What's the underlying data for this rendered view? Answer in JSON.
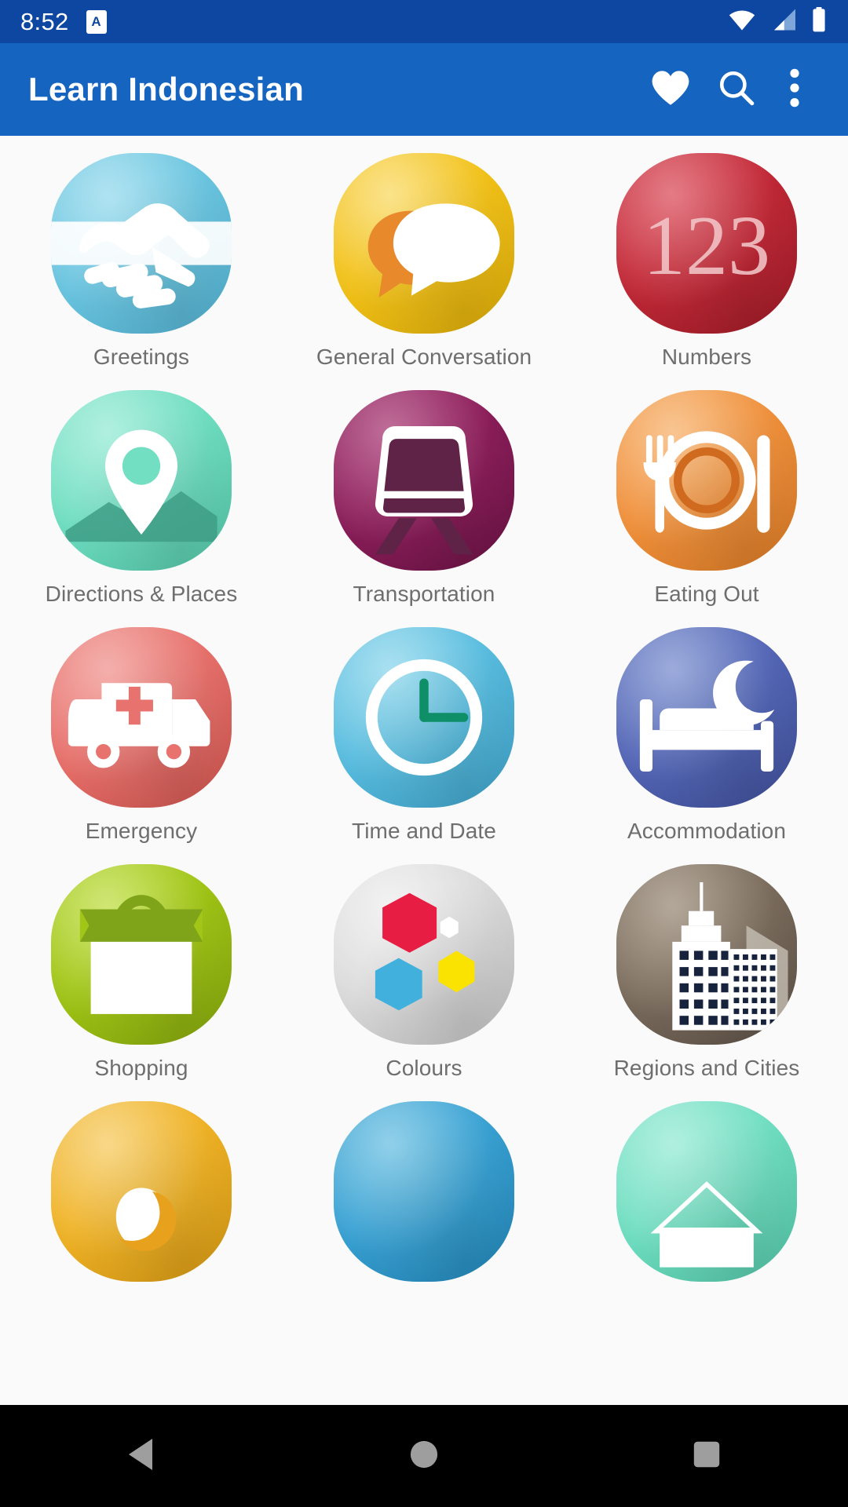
{
  "status_bar": {
    "time": "8:52",
    "app_badge_letter": "A",
    "icons": [
      "wifi-icon",
      "cell-signal-icon",
      "battery-icon"
    ],
    "background": "#0D47A1"
  },
  "app_bar": {
    "title": "Learn Indonesian",
    "background": "#1565C0",
    "actions": [
      {
        "name": "favorites-button",
        "icon": "heart-icon"
      },
      {
        "name": "search-button",
        "icon": "search-icon"
      },
      {
        "name": "overflow-menu-button",
        "icon": "more-vertical-icon"
      }
    ]
  },
  "grid": {
    "columns": 3,
    "background": "#FAFAFA",
    "label_color": "#6E6E6E",
    "categories": [
      {
        "label": "Greetings",
        "icon": "handshake-icon",
        "color": "#6FC7E1",
        "color_dark": "#4FB3D4"
      },
      {
        "label": "General Conversation",
        "icon": "speech-bubbles-icon",
        "color": "#F2C21A",
        "color_dark": "#E8B400"
      },
      {
        "label": "Numbers",
        "icon": "numbers-123-icon",
        "color": "#C42A38",
        "color_dark": "#A81F2C"
      },
      {
        "label": "Directions & Places",
        "icon": "map-pin-icon",
        "color": "#72DFC2",
        "color_dark": "#56CCAC"
      },
      {
        "label": "Transportation",
        "icon": "train-icon",
        "color": "#8E1F5C",
        "color_dark": "#6E1548"
      },
      {
        "label": "Eating Out",
        "icon": "cutlery-plate-icon",
        "color": "#F0923E",
        "color_dark": "#E07B24"
      },
      {
        "label": "Emergency",
        "icon": "ambulance-icon",
        "color": "#E8736E",
        "color_dark": "#D9554F"
      },
      {
        "label": "Time and Date",
        "icon": "clock-icon",
        "color": "#5BBEE0",
        "color_dark": "#3FA9D0"
      },
      {
        "label": "Accommodation",
        "icon": "bed-moon-icon",
        "color": "#5568B8",
        "color_dark": "#3F509E"
      },
      {
        "label": "Shopping",
        "icon": "shopping-bag-icon",
        "color": "#A2C617",
        "color_dark": "#87A80D"
      },
      {
        "label": "Colours",
        "icon": "color-shapes-icon",
        "color": "#DCDCDC",
        "color_dark": "#C6C6C6"
      },
      {
        "label": "Regions and Cities",
        "icon": "city-skyline-icon",
        "color": "#7D6E5E",
        "color_dark": "#61544A"
      },
      {
        "label": "",
        "icon": "partial-yellow-icon",
        "color": "#F0B429",
        "color_dark": "#DC9C12"
      },
      {
        "label": "",
        "icon": "partial-blue-icon",
        "color": "#3BA3D4",
        "color_dark": "#2289BC"
      },
      {
        "label": "",
        "icon": "partial-teal-icon",
        "color": "#72DFC2",
        "color_dark": "#56CCAC"
      }
    ]
  },
  "nav_bar": {
    "background": "#000000",
    "buttons": [
      {
        "name": "back-button",
        "icon": "triangle-back-icon"
      },
      {
        "name": "home-button",
        "icon": "circle-home-icon"
      },
      {
        "name": "recents-button",
        "icon": "square-recents-icon"
      }
    ]
  }
}
